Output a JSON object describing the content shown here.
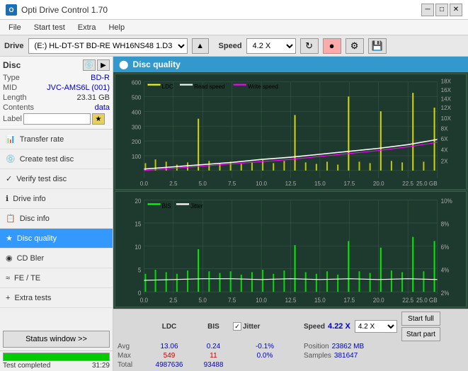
{
  "titleBar": {
    "title": "Opti Drive Control 1.70",
    "minBtn": "─",
    "maxBtn": "□",
    "closeBtn": "✕"
  },
  "menuBar": {
    "items": [
      "File",
      "Start test",
      "Extra",
      "Help"
    ]
  },
  "driveBar": {
    "label": "Drive",
    "driveValue": "(E:) HL-DT-ST BD-RE  WH16NS48 1.D3",
    "speedLabel": "Speed",
    "speedValue": "4.2 X"
  },
  "disc": {
    "label": "Disc",
    "typeLabel": "Type",
    "typeValue": "BD-R",
    "midLabel": "MID",
    "midValue": "JVC-AMS6L (001)",
    "lengthLabel": "Length",
    "lengthValue": "23.31 GB",
    "contentsLabel": "Contents",
    "contentsValue": "data",
    "labelLabel": "Label",
    "labelPlaceholder": ""
  },
  "navItems": [
    {
      "id": "transfer-rate",
      "label": "Transfer rate",
      "icon": "📊"
    },
    {
      "id": "create-test-disc",
      "label": "Create test disc",
      "icon": "💿"
    },
    {
      "id": "verify-test-disc",
      "label": "Verify test disc",
      "icon": "✓"
    },
    {
      "id": "drive-info",
      "label": "Drive info",
      "icon": "ℹ"
    },
    {
      "id": "disc-info",
      "label": "Disc info",
      "icon": "📋"
    },
    {
      "id": "disc-quality",
      "label": "Disc quality",
      "icon": "★",
      "active": true
    },
    {
      "id": "cd-bler",
      "label": "CD Bler",
      "icon": "◉"
    },
    {
      "id": "fe-te",
      "label": "FE / TE",
      "icon": "≈"
    },
    {
      "id": "extra-tests",
      "label": "Extra tests",
      "icon": "+"
    }
  ],
  "statusBtn": "Status window >>",
  "progress": {
    "percent": 100,
    "statusText": "Test completed",
    "timeText": "31:29"
  },
  "discQuality": {
    "title": "Disc quality"
  },
  "chart1": {
    "legend": [
      {
        "label": "LDC",
        "color": "#ffff00"
      },
      {
        "label": "Read speed",
        "color": "#ffffff"
      },
      {
        "label": "Write speed",
        "color": "#ff00ff"
      }
    ],
    "yMax": 600,
    "yLabels": [
      "600",
      "500",
      "400",
      "300",
      "200",
      "100",
      "0"
    ],
    "yRight": [
      "18X",
      "16X",
      "14X",
      "12X",
      "10X",
      "8X",
      "6X",
      "4X",
      "2X"
    ],
    "xLabels": [
      "0.0",
      "2.5",
      "5.0",
      "7.5",
      "10.0",
      "12.5",
      "15.0",
      "17.5",
      "20.0",
      "22.5",
      "25.0 GB"
    ]
  },
  "chart2": {
    "legend": [
      {
        "label": "BIS",
        "color": "#00ff00"
      },
      {
        "label": "Jitter",
        "color": "#ffffff"
      }
    ],
    "yMax": 20,
    "yLabels": [
      "20",
      "15",
      "10",
      "5",
      "0"
    ],
    "yRight": [
      "10%",
      "8%",
      "6%",
      "4%",
      "2%"
    ],
    "xLabels": [
      "0.0",
      "2.5",
      "5.0",
      "7.5",
      "10.0",
      "12.5",
      "15.0",
      "17.5",
      "20.0",
      "22.5",
      "25.0 GB"
    ]
  },
  "stats": {
    "ldcLabel": "LDC",
    "bisLabel": "BIS",
    "jitterLabel": "Jitter",
    "speedLabel": "Speed",
    "avgLabel": "Avg",
    "maxLabel": "Max",
    "totalLabel": "Total",
    "avgLDC": "13.06",
    "avgBIS": "0.24",
    "avgJitter": "-0.1%",
    "maxLDC": "549",
    "maxBIS": "11",
    "maxJitter": "0.0%",
    "totalLDC": "4987636",
    "totalBIS": "93488",
    "speedVal": "4.22 X",
    "positionLabel": "Position",
    "positionVal": "23862 MB",
    "samplesLabel": "Samples",
    "samplesVal": "381647",
    "startFull": "Start full",
    "startPart": "Start part",
    "speedSelectVal": "4.2 X"
  }
}
